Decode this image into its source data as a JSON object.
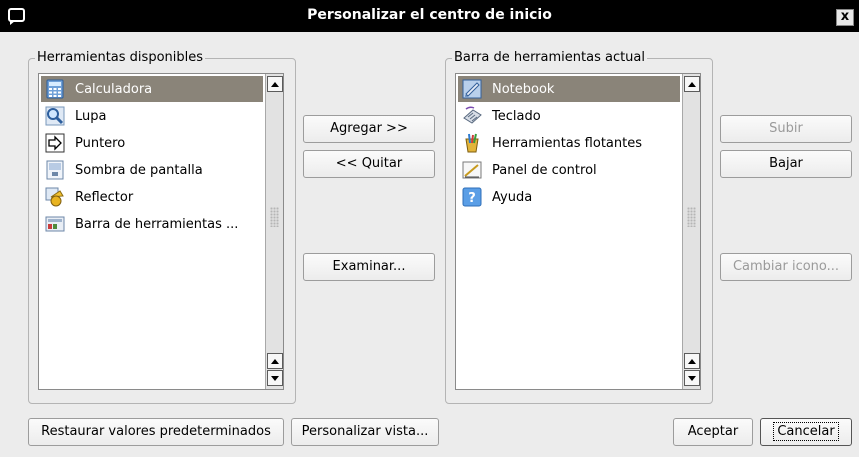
{
  "window": {
    "title": "Personalizar el centro de inicio",
    "close_label": "x"
  },
  "available": {
    "legend": "Herramientas disponibles",
    "items": [
      {
        "label": "Calculadora",
        "icon": "calculator-icon",
        "selected": true
      },
      {
        "label": "Lupa",
        "icon": "magnifier-icon",
        "selected": false
      },
      {
        "label": "Puntero",
        "icon": "pointer-icon",
        "selected": false
      },
      {
        "label": "Sombra de pantalla",
        "icon": "screen-shade-icon",
        "selected": false
      },
      {
        "label": "Reflector",
        "icon": "spotlight-icon",
        "selected": false
      },
      {
        "label": "Barra de herramientas ...",
        "icon": "toolbar-icon",
        "selected": false
      }
    ]
  },
  "current": {
    "legend": "Barra de herramientas actual",
    "items": [
      {
        "label": "Notebook",
        "icon": "notebook-icon",
        "selected": true
      },
      {
        "label": "Teclado",
        "icon": "keyboard-icon",
        "selected": false
      },
      {
        "label": "Herramientas flotantes",
        "icon": "floating-tools-icon",
        "selected": false
      },
      {
        "label": "Panel de control",
        "icon": "control-panel-icon",
        "selected": false
      },
      {
        "label": "Ayuda",
        "icon": "help-icon",
        "selected": false
      }
    ]
  },
  "middle_buttons": {
    "add": "Agregar >>",
    "remove": "<< Quitar",
    "browse": "Examinar..."
  },
  "right_buttons": {
    "up": "Subir",
    "down": "Bajar",
    "change_icon": "Cambiar icono..."
  },
  "bottom_buttons": {
    "restore": "Restaurar valores predeterminados",
    "customize_view": "Personalizar vista...",
    "accept": "Aceptar",
    "cancel": "Cancelar"
  },
  "colors": {
    "selection": "#8a8479",
    "titlebar": "#000000",
    "dialog_bg": "#ececec"
  }
}
